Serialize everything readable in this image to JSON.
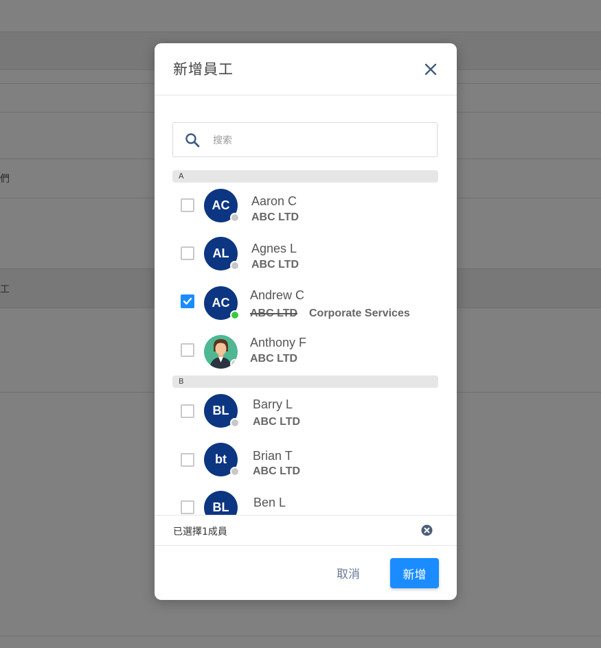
{
  "background": {
    "snippets": [
      "們",
      "工"
    ]
  },
  "modal": {
    "title": "新增員工",
    "close_icon": "close-icon",
    "search": {
      "placeholder": "搜索",
      "value": ""
    },
    "sections": [
      {
        "letter": "A",
        "members": [
          {
            "initials": "AC",
            "name": "Aaron C",
            "company": "ABC LTD",
            "checked": false,
            "status": "offline"
          },
          {
            "initials": "AL",
            "name": "Agnes L",
            "company": "ABC LTD",
            "checked": false,
            "status": "offline"
          },
          {
            "initials": "AC",
            "name": "Andrew C",
            "company": "ABC LTD",
            "department": "Corporate Services",
            "checked": true,
            "status": "online"
          },
          {
            "initials": "",
            "name": "Anthony F",
            "company": "ABC LTD",
            "checked": false,
            "status": "offline",
            "avatar": "person-photo"
          }
        ]
      },
      {
        "letter": "B",
        "members": [
          {
            "initials": "BL",
            "name": "Barry L",
            "company": "ABC LTD",
            "checked": false,
            "status": "offline"
          },
          {
            "initials": "bt",
            "name": "Brian T",
            "company": "ABC LTD",
            "checked": false,
            "status": "offline"
          },
          {
            "initials": "BL",
            "name": "Ben L",
            "checked": false,
            "status": "offline"
          }
        ]
      }
    ],
    "selected_summary": "已選擇1成員",
    "cancel_label": "取消",
    "add_label": "新增"
  },
  "colors": {
    "accent": "#1a8cff",
    "avatar_bg": "#0d3682",
    "online": "#3cc93c",
    "offline": "#c8c8c8"
  }
}
